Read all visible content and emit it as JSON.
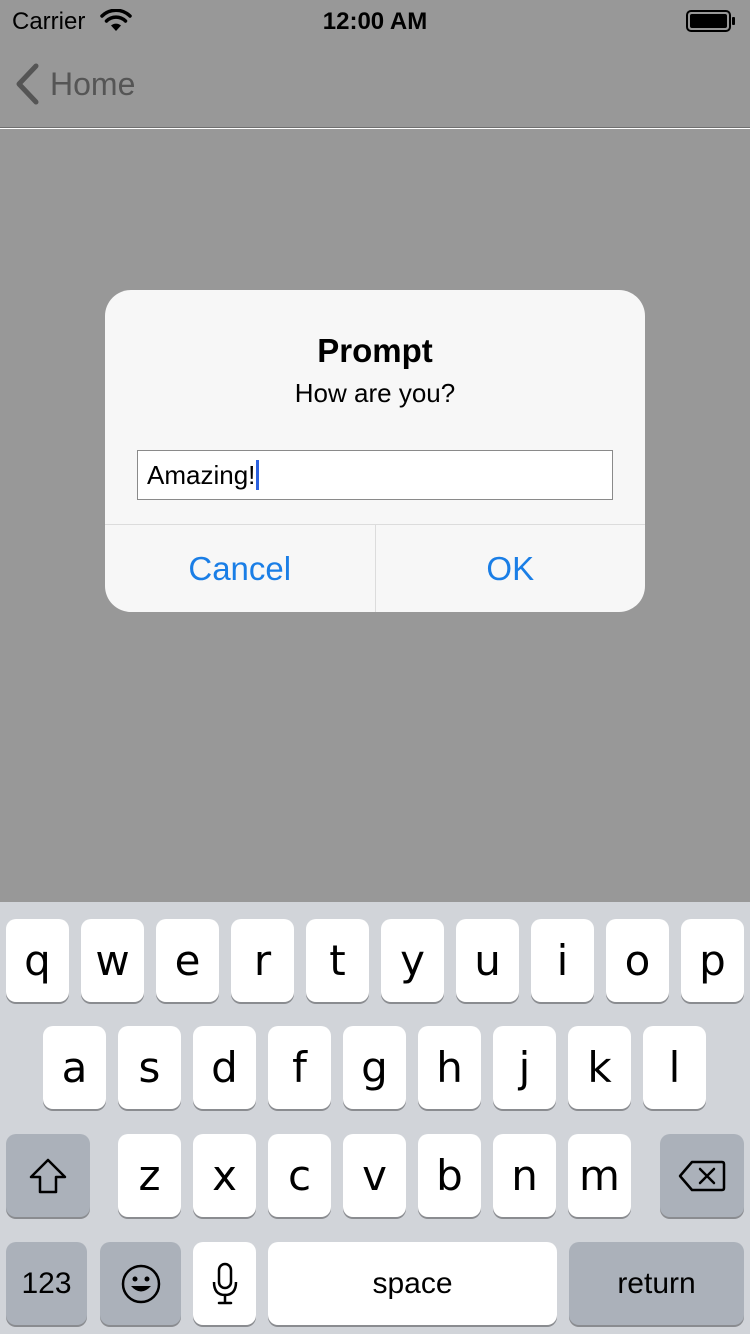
{
  "status_bar": {
    "carrier": "Carrier",
    "time": "12:00 AM",
    "wifi_icon": "wifi-icon",
    "battery_icon": "battery-icon"
  },
  "nav_bar": {
    "back_label": "Home",
    "back_icon": "chevron-left-icon"
  },
  "alert": {
    "title": "Prompt",
    "message": "How are you?",
    "input_value": "Amazing!",
    "cancel_label": "Cancel",
    "ok_label": "OK"
  },
  "keyboard": {
    "row1": [
      "q",
      "w",
      "e",
      "r",
      "t",
      "y",
      "u",
      "i",
      "o",
      "p"
    ],
    "row2": [
      "a",
      "s",
      "d",
      "f",
      "g",
      "h",
      "j",
      "k",
      "l"
    ],
    "row3": [
      "z",
      "x",
      "c",
      "v",
      "b",
      "n",
      "m"
    ],
    "numbers_label": "123",
    "space_label": "space",
    "return_label": "return",
    "shift_icon": "shift-icon",
    "delete_icon": "delete-icon",
    "emoji_icon": "emoji-icon",
    "mic_icon": "microphone-icon"
  },
  "colors": {
    "accent": "#1a7ee6",
    "dim_background": "#989898",
    "keyboard_background": "#d1d4d9"
  }
}
